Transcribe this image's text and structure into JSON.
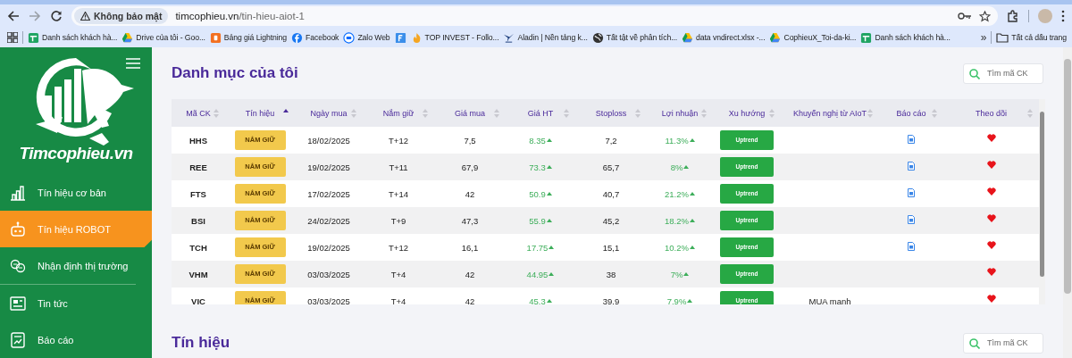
{
  "browser": {
    "security_label": "Không bảo mật",
    "url_domain": "timcophieu.vn",
    "url_path": "/tin-hieu-aiot-1",
    "forward_disabled": true,
    "bookmarks": [
      {
        "kind": "link",
        "label": "Danh sách khách hà..."
      },
      {
        "kind": "link",
        "label": "Drive của tôi - Goo..."
      },
      {
        "kind": "link",
        "label": "Bảng giá Lightning"
      },
      {
        "kind": "link",
        "label": "Facebook"
      },
      {
        "kind": "link",
        "label": "Zalo Web"
      },
      {
        "kind": "icon"
      },
      {
        "kind": "link",
        "label": "TOP INVEST - Follo..."
      },
      {
        "kind": "link",
        "label": "Aladin | Nền tảng k..."
      },
      {
        "kind": "link",
        "label": "Tất tật về phân tích..."
      },
      {
        "kind": "link",
        "label": "data vndirect.xlsx -..."
      },
      {
        "kind": "link",
        "label": "CophieuX_Toi-da-ki..."
      },
      {
        "kind": "link",
        "label": "Danh sách khách hà..."
      }
    ],
    "overflow": "»",
    "all_bookmarks": "Tất cả dấu trang"
  },
  "sidebar": {
    "logo_text": "Timcophieu.vn",
    "items": [
      {
        "label": "Tín hiệu cơ bản",
        "selected": false
      },
      {
        "label": "Tín hiệu ROBOT",
        "selected": true
      },
      {
        "label": "Nhận định thị trường",
        "selected": false,
        "divider_after": true
      },
      {
        "label": "Tin tức",
        "selected": false
      },
      {
        "label": "Báo cáo",
        "selected": false
      }
    ]
  },
  "portfolio": {
    "title": "Danh mục của tôi",
    "search": {
      "placeholder": "Tìm mã CK"
    },
    "columns": [
      {
        "label": "Mã CK",
        "sorted": false
      },
      {
        "label": "Tín hiệu",
        "sorted": true
      },
      {
        "label": "Ngày mua",
        "sorted": false
      },
      {
        "label": "Nắm giữ",
        "sorted": false
      },
      {
        "label": "Giá mua",
        "sorted": false
      },
      {
        "label": "Giá HT",
        "sorted": false
      },
      {
        "label": "Stoploss",
        "sorted": false
      },
      {
        "label": "Lợi nhuận",
        "sorted": false
      },
      {
        "label": "Xu hướng",
        "sorted": false
      },
      {
        "label": "Khuyến nghị từ AIoT",
        "sorted": false
      },
      {
        "label": "Báo cáo",
        "sorted": false
      },
      {
        "label": "Theo dõi",
        "sorted": false
      }
    ],
    "rows": [
      {
        "code": "HHS",
        "signal": "NẮM GIỮ",
        "buy_date": "18/02/2025",
        "hold": "T+12",
        "buy_price": "7,5",
        "current_price": "8.35",
        "rising": true,
        "stoploss": "7,2",
        "profit": "11.3%",
        "trend": "Uptrend",
        "report": true,
        "followed": true
      },
      {
        "code": "REE",
        "signal": "NẮM GIỮ",
        "buy_date": "19/02/2025",
        "hold": "T+11",
        "buy_price": "67,9",
        "current_price": "73.3",
        "rising": true,
        "stoploss": "65,7",
        "profit": "8%",
        "trend": "Uptrend",
        "report": true,
        "followed": true
      },
      {
        "code": "FTS",
        "signal": "NẮM GIỮ",
        "buy_date": "17/02/2025",
        "hold": "T+14",
        "buy_price": "42",
        "current_price": "50.9",
        "rising": true,
        "stoploss": "40,7",
        "profit": "21.2%",
        "trend": "Uptrend",
        "report": true,
        "followed": true
      },
      {
        "code": "BSI",
        "signal": "NẮM GIỮ",
        "buy_date": "24/02/2025",
        "hold": "T+9",
        "buy_price": "47,3",
        "current_price": "55.9",
        "rising": true,
        "stoploss": "45,2",
        "profit": "18.2%",
        "trend": "Uptrend",
        "report": true,
        "followed": true
      },
      {
        "code": "TCH",
        "signal": "NẮM GIỮ",
        "buy_date": "19/02/2025",
        "hold": "T+12",
        "buy_price": "16,1",
        "current_price": "17.75",
        "rising": true,
        "stoploss": "15,1",
        "profit": "10.2%",
        "trend": "Uptrend",
        "report": true,
        "followed": true
      },
      {
        "code": "VHM",
        "signal": "NẮM GIỮ",
        "buy_date": "03/03/2025",
        "hold": "T+4",
        "buy_price": "42",
        "current_price": "44.95",
        "rising": true,
        "stoploss": "38",
        "profit": "7%",
        "trend": "Uptrend",
        "report": false,
        "followed": true
      },
      {
        "code": "VIC",
        "signal": "NẮM GIỮ",
        "buy_date": "03/03/2025",
        "hold": "T+4",
        "buy_price": "42",
        "current_price": "45.3",
        "rising": true,
        "stoploss": "39,9",
        "profit": "7.9%",
        "trend": "Uptrend",
        "recommendation": "MUA mạnh",
        "report": false,
        "followed": true
      }
    ]
  },
  "signals": {
    "title": "Tín hiệu",
    "search": {
      "placeholder": "Tìm mã CK"
    }
  }
}
